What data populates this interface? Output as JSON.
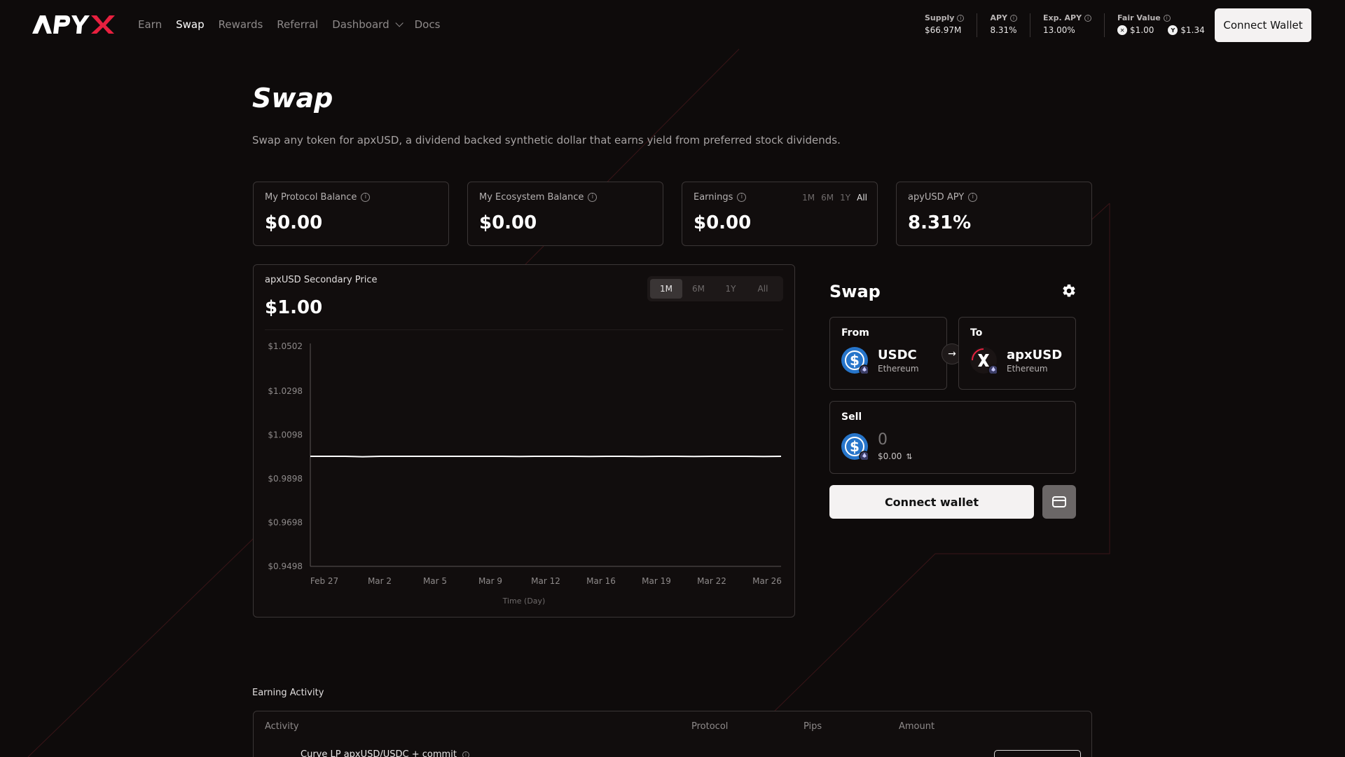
{
  "brand": {
    "logo_text": "APYX",
    "accent": "#e8203f"
  },
  "nav": {
    "items": [
      {
        "label": "Earn",
        "active": false
      },
      {
        "label": "Swap",
        "active": true
      },
      {
        "label": "Rewards",
        "active": false
      },
      {
        "label": "Referral",
        "active": false
      },
      {
        "label": "Dashboard",
        "active": false,
        "dropdown": true
      },
      {
        "label": "Docs",
        "active": false
      }
    ]
  },
  "stats": {
    "supply": {
      "label": "Supply",
      "value": "$66.97M"
    },
    "apy": {
      "label": "APY",
      "value": "8.31%"
    },
    "exp_apy": {
      "label": "Exp. APY",
      "value": "13.00%"
    },
    "fair_value": {
      "label": "Fair Value",
      "x_value": "$1.00",
      "y_value": "$1.34"
    }
  },
  "header": {
    "connect_wallet_label": "Connect Wallet"
  },
  "page": {
    "title": "Swap",
    "subtitle": "Swap any token for apxUSD, a dividend backed synthetic dollar that earns yield from preferred stock dividends."
  },
  "cards": [
    {
      "label": "My Protocol Balance",
      "value": "$0.00"
    },
    {
      "label": "My Ecosystem Balance",
      "value": "$0.00"
    },
    {
      "label": "Earnings",
      "value": "$0.00",
      "ranges": [
        "1M",
        "6M",
        "1Y",
        "All"
      ],
      "active_range": "All"
    },
    {
      "label": "apyUSD APY",
      "value": "8.31%"
    }
  ],
  "chart_panel": {
    "title": "apxUSD Secondary Price",
    "price": "$1.00",
    "ranges": [
      "1M",
      "6M",
      "1Y",
      "All"
    ],
    "active_range": "1M"
  },
  "chart_data": {
    "type": "line",
    "title": "apxUSD Secondary Price",
    "xlabel": "Time (Day)",
    "ylabel": "",
    "x_tick_labels": [
      "Feb 27",
      "Mar 2",
      "Mar 5",
      "Mar 9",
      "Mar 12",
      "Mar 16",
      "Mar 19",
      "Mar 22",
      "Mar 26"
    ],
    "y_tick_labels": [
      "$1.0502",
      "$1.0298",
      "$1.0098",
      "$0.9898",
      "$0.9698",
      "$0.9498"
    ],
    "y_ticks": [
      1.0502,
      1.0298,
      1.0098,
      0.9898,
      0.9698,
      0.9498
    ],
    "ylim": [
      0.9498,
      1.0502
    ],
    "grid": false,
    "series": [
      {
        "color": "#ffffff",
        "values": [
          1.0,
          1.0,
          1.0,
          0.9998,
          1.0,
          1.0,
          1.0,
          1.0,
          1.0,
          1.0,
          1.0,
          1.0,
          0.9999,
          1.0,
          1.0,
          1.0,
          0.9999,
          1.0,
          1.0,
          0.9999,
          1.0,
          1.0,
          0.9999,
          1.0,
          1.0,
          1.0,
          0.9999,
          1.0
        ]
      }
    ]
  },
  "swap": {
    "title": "Swap",
    "from": {
      "label": "From",
      "token": "USDC",
      "chain": "Ethereum"
    },
    "to": {
      "label": "To",
      "token": "apxUSD",
      "chain": "Ethereum"
    },
    "sell": {
      "label": "Sell",
      "amount": "0",
      "usd": "$0.00"
    },
    "connect_label": "Connect wallet"
  },
  "activity": {
    "title": "Earning Activity",
    "columns": [
      "Activity",
      "Protocol",
      "Pips",
      "Amount"
    ],
    "rows": [
      {
        "activity": "Curve LP apxUSD/USDC + commit"
      }
    ]
  }
}
